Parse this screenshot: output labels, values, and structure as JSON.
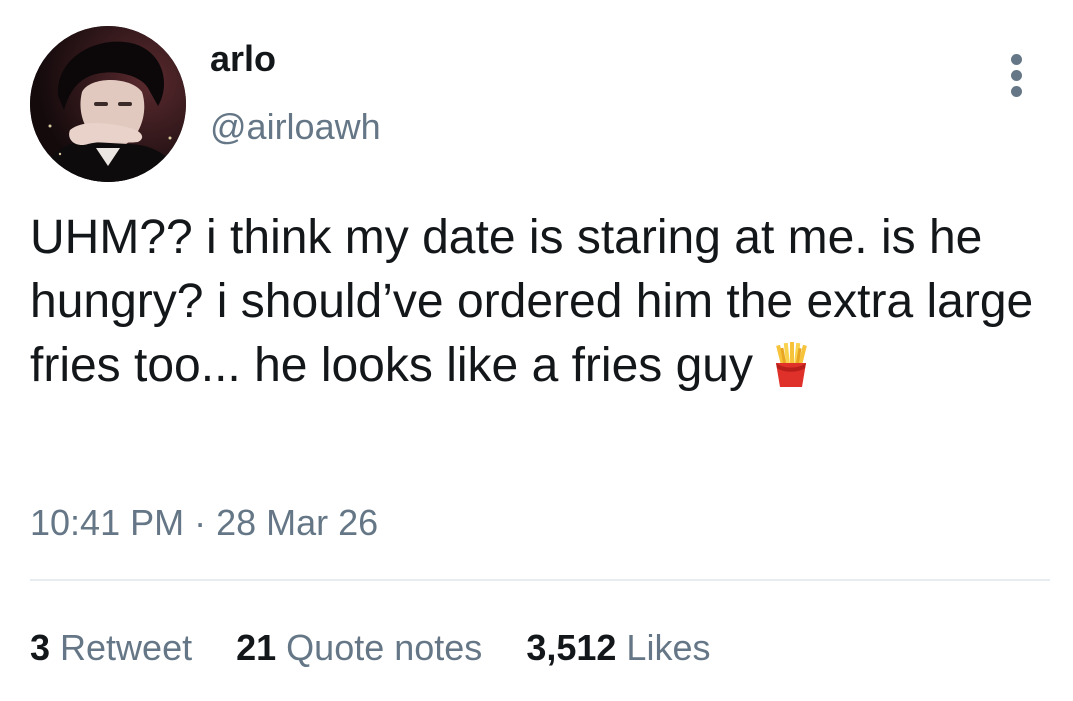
{
  "author": {
    "display_name": "arlo",
    "handle": "@airloawh"
  },
  "tweet": {
    "text": "UHM?? i think my date is staring at me. is he hungry? i should’ve ordered him the extra large fries too... he looks like a fries guy",
    "emoji": "fries-icon",
    "time": "10:41 PM",
    "date": "28 Mar 26",
    "separator": "·"
  },
  "stats": [
    {
      "count": "3",
      "label": "Retweet"
    },
    {
      "count": "21",
      "label": "Quote notes"
    },
    {
      "count": "3,512",
      "label": "Likes"
    }
  ],
  "colors": {
    "text_primary": "#14171a",
    "text_secondary": "#657786",
    "divider": "#e6ecf0",
    "background": "#ffffff"
  }
}
